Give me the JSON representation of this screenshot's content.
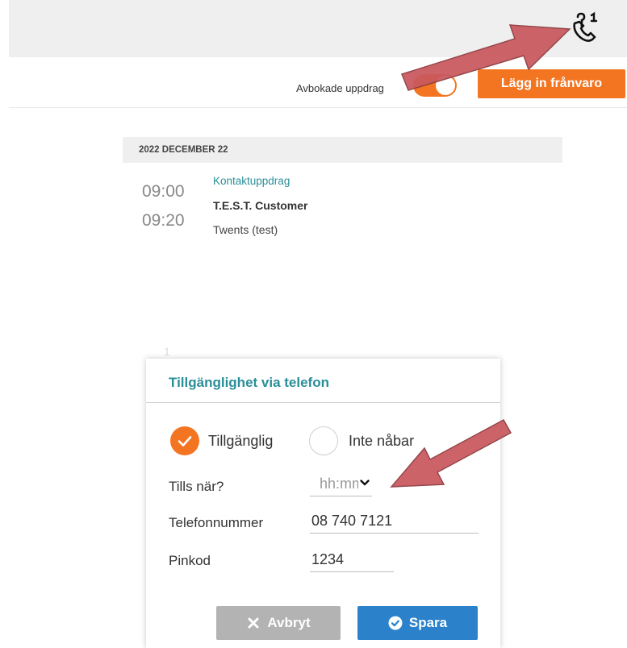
{
  "header": {
    "phone_icon": "phone-question-icon"
  },
  "toolbar": {
    "toggle_label": "Avbokade uppdrag",
    "toggle_on": true,
    "absence_button": "Lägg in frånvaro",
    "accent_color": "#f37521"
  },
  "schedule": {
    "date_header": "2022 DECEMBER 22",
    "appointment": {
      "start": "09:00",
      "end": "09:20",
      "type": "Kontaktuppdrag",
      "customer": "T.E.S.T. Customer",
      "place": "Twents (test)"
    }
  },
  "faint_text": "1",
  "dialog": {
    "title": "Tillgänglighet via telefon",
    "options": [
      {
        "label": "Tillgänglig",
        "checked": true
      },
      {
        "label": "Inte nåbar",
        "checked": false
      }
    ],
    "until_label": "Tills när?",
    "until_placeholder": "hh:mm",
    "phone_label": "Telefonnummer",
    "phone_value": "08 740 7121",
    "pin_label": "Pinkod",
    "pin_value": "1234",
    "cancel_label": "Avbryt",
    "save_label": "Spara",
    "save_color": "#2b82cb",
    "cancel_color": "#b3b3b3"
  }
}
